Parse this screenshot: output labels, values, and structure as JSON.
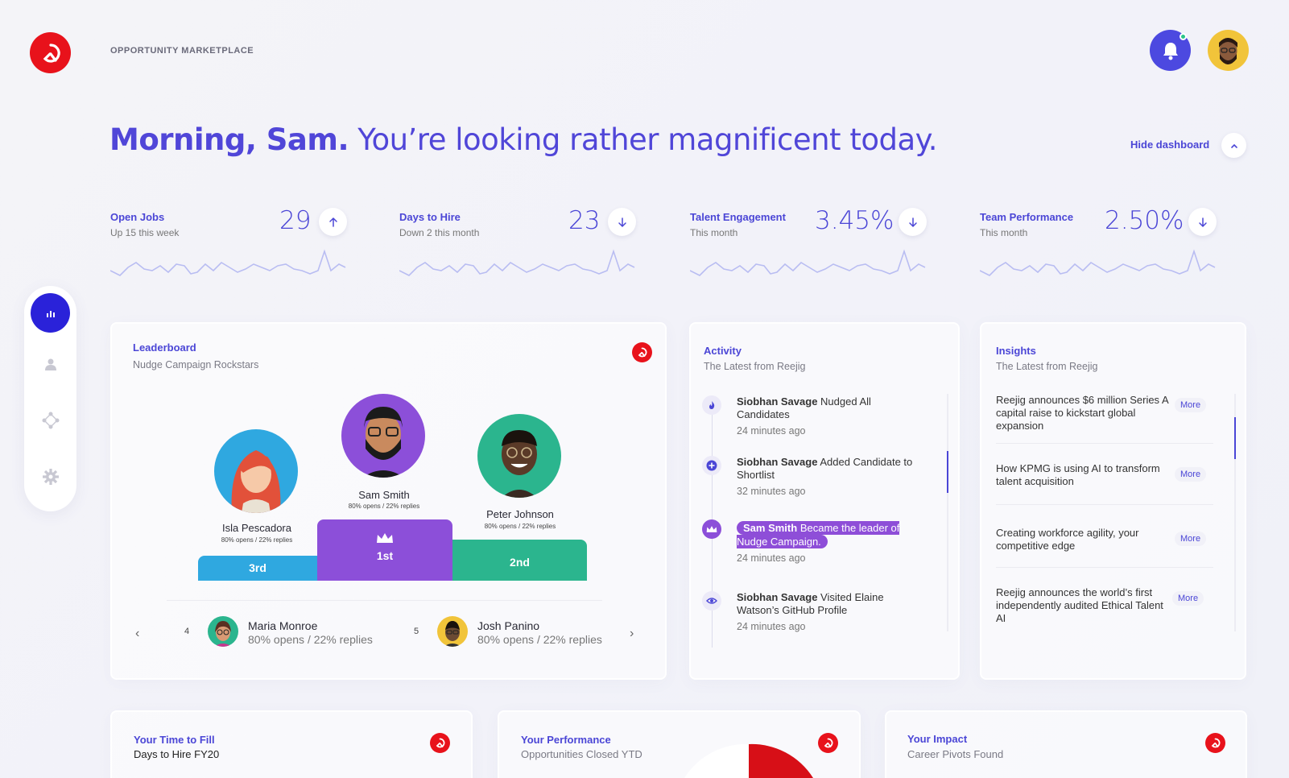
{
  "brand": "OPPORTUNITY MARKETPLACE",
  "greeting": {
    "bold": "Morning, Sam.",
    "rest": "You’re looking rather magnificent today."
  },
  "hide_dashboard": "Hide dashboard",
  "stats": [
    {
      "title": "Open Jobs",
      "sub": "Up 15 this week",
      "value": "29",
      "trend": "up"
    },
    {
      "title": "Days to Hire",
      "sub": "Down 2 this month",
      "value": "23",
      "trend": "down"
    },
    {
      "title": "Talent Engagement",
      "sub": "This month",
      "value": "3.45%",
      "trend": "down"
    },
    {
      "title": "Team Performance",
      "sub": "This month",
      "value": "2.50%",
      "trend": "down"
    }
  ],
  "nav": [
    "chart-icon",
    "person-icon",
    "network-icon",
    "gear-icon"
  ],
  "leaderboard": {
    "title": "Leaderboard",
    "sub": "Nudge Campaign Rockstars",
    "podium": [
      {
        "rank": "3rd",
        "name": "Isla Pescadora",
        "stat": "80% opens / 22% replies",
        "color": "#2fa8e0"
      },
      {
        "rank": "1st",
        "name": "Sam Smith",
        "stat": "80% opens / 22% replies",
        "color": "#8c4fd9"
      },
      {
        "rank": "2nd",
        "name": "Peter Johnson",
        "stat": "80% opens / 22% replies",
        "color": "#2bb58e"
      }
    ],
    "rows": [
      {
        "num": "4",
        "name": "Maria Monroe",
        "stat": "80% opens / 22% replies"
      },
      {
        "num": "5",
        "name": "Josh Panino",
        "stat": "80% opens / 22% replies"
      }
    ],
    "prev": "‹",
    "next": "›"
  },
  "activity": {
    "title": "Activity",
    "sub": "The Latest from Reejig",
    "items": [
      {
        "who": "Siobhan Savage",
        "what": "Nudged All Candidates",
        "time": "24 minutes ago",
        "icon": "fire-icon"
      },
      {
        "who": "Siobhan Savage",
        "what": "Added Candidate to Shortlist",
        "time": "32 minutes ago",
        "icon": "plus-icon"
      },
      {
        "who": "Sam Smith",
        "what": "Became the leader of Nudge Campaign.",
        "time": "24 minutes ago",
        "icon": "crown-icon"
      },
      {
        "who": "Siobhan Savage",
        "what": "Visited Elaine Watson’s GitHub Profile",
        "time": "24 minutes ago",
        "icon": "eye-icon"
      }
    ]
  },
  "insights": {
    "title": "Insights",
    "sub": "The Latest from Reejig",
    "more": "More",
    "items": [
      "Reejig announces $6 million Series A capital raise to kickstart global expansion",
      "How KPMG is using AI to transform talent acquisition",
      "Creating workforce agility, your competitive edge",
      "Reejig announces the world’s first independently audited Ethical Talent AI"
    ]
  },
  "bottom": [
    {
      "title": "Your Time to Fill",
      "sub": "Days to Hire FY20"
    },
    {
      "title": "Your Performance",
      "sub": "Opportunities Closed YTD"
    },
    {
      "title": "Your Impact",
      "sub": "Career Pivots Found"
    }
  ],
  "colors": {
    "accent": "#4b46d6",
    "brand_red": "#e8121b",
    "third": "#2fa8e0",
    "first": "#8c4fd9",
    "second": "#2bb58e"
  }
}
